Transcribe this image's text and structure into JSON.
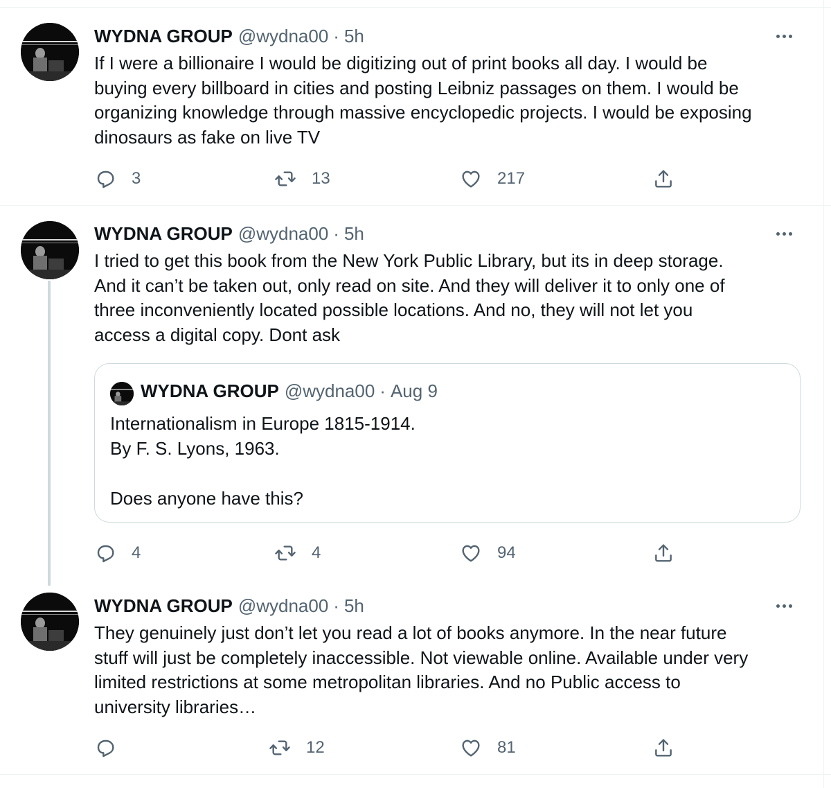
{
  "colors": {
    "text": "#0f1419",
    "secondary": "#536471",
    "border": "#cfd9de",
    "divider": "#eff3f4"
  },
  "icons": {
    "reply": "reply-icon",
    "retweet": "retweet-icon",
    "like": "heart-icon",
    "share": "share-icon",
    "more": "more-icon"
  },
  "tweets": [
    {
      "name": "WYDNA GROUP",
      "handle": "@wydna00",
      "separator": "·",
      "time": "5h",
      "lines": [
        "If I were a billionaire I would be digitizing out of print books all day. I would be",
        "buying every billboard in cities and posting Leibniz passages on them. I would be",
        "organizing knowledge through massive encyclopedic projects. I would be exposing",
        "dinosaurs as fake on live TV"
      ],
      "replies": "3",
      "retweets": "13",
      "likes": "217"
    },
    {
      "name": "WYDNA GROUP",
      "handle": "@wydna00",
      "separator": "·",
      "time": "5h",
      "lines": [
        "I tried to get this book from the New York Public Library, but its in deep storage.",
        "And it can’t be taken out, only read on site. And they will deliver it to only one of",
        "three inconveniently located possible locations. And no, they will not let you",
        "access a digital copy. Dont ask"
      ],
      "quote": {
        "name": "WYDNA GROUP",
        "handle": "@wydna00",
        "separator": "·",
        "time": "Aug 9",
        "lines": [
          "Internationalism in Europe 1815-1914.",
          "By F. S. Lyons, 1963.",
          "",
          "Does anyone have this?"
        ]
      },
      "replies": "4",
      "retweets": "4",
      "likes": "94"
    },
    {
      "name": "WYDNA GROUP",
      "handle": "@wydna00",
      "separator": "·",
      "time": "5h",
      "lines": [
        "They genuinely just don’t let you read a lot of books anymore. In the near future",
        "stuff will just be completely inaccessible. Not viewable online. Available under very",
        "limited restrictions at some metropolitan libraries. And no Public access to",
        "university libraries…"
      ],
      "replies": "",
      "retweets": "12",
      "likes": "81"
    }
  ]
}
